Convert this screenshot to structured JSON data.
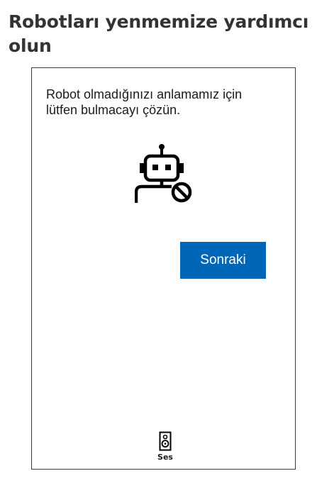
{
  "page": {
    "title": "Robotları yenmemize yardımcı olun"
  },
  "challenge": {
    "instruction": "Robot olmadığınızı anlamamız için lütfen bulmacayı çözün.",
    "illustration_icon": "robot-blocked-icon",
    "next_label": "Sonraki",
    "audio_icon": "speaker-icon",
    "audio_label": "Ses"
  },
  "colors": {
    "accent": "#0067b8",
    "title": "#333333",
    "text": "#1b1b1b",
    "border": "#3a3a3a"
  }
}
